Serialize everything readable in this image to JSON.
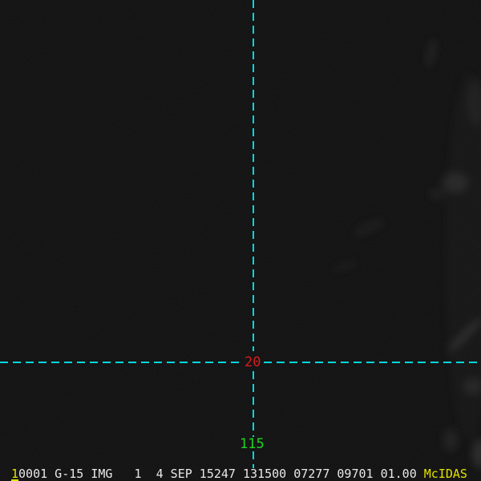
{
  "image_annotations": {
    "latitude_value": "20",
    "longitude_value": "115"
  },
  "status_bar": {
    "frame_number": "1",
    "info": "0001 G-15 IMG   1  4 SEP 15247 131500 07277 09701 01.00 ",
    "brand": "McIDAS"
  },
  "colors": {
    "crosshair_cyan": "#00d9dc",
    "latitude_label_red": "#d41e1e",
    "longitude_label_green": "#1fd41f",
    "status_text_white": "#e8e8e8",
    "status_accent_yellow": "#e2e200",
    "image_background": "#060607"
  }
}
